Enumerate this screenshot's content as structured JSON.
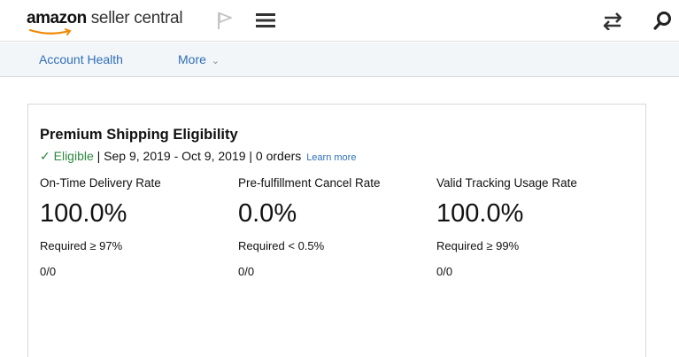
{
  "header": {
    "logo_brand": "amazon",
    "logo_suffix": " seller central",
    "icons": [
      "flag-icon",
      "menu-icon",
      "swap-icon",
      "search-icon"
    ]
  },
  "subnav": {
    "account_health": "Account Health",
    "more": "More",
    "more_chevron": "⌄"
  },
  "card": {
    "title": "Premium Shipping Eligibility",
    "status_check": "✓",
    "status_label": "Eligible",
    "status_details": " | Sep 9, 2019 - Oct 9, 2019 | 0 orders",
    "learn_more": "Learn more",
    "metrics": [
      {
        "label": "On-Time Delivery Rate",
        "value": "100.0%",
        "requirement": "Required ≥ 97%",
        "count": "0/0"
      },
      {
        "label": "Pre-fulfillment Cancel Rate",
        "value": "0.0%",
        "requirement": "Required < 0.5%",
        "count": "0/0"
      },
      {
        "label": "Valid Tracking Usage Rate",
        "value": "100.0%",
        "requirement": "Required ≥ 99%",
        "count": "0/0"
      }
    ]
  },
  "colors": {
    "link": "#2e6fb7",
    "eligible": "#2d8a3e",
    "subnav_bg": "#f3f6f9",
    "logo_smile": "#f08804"
  }
}
